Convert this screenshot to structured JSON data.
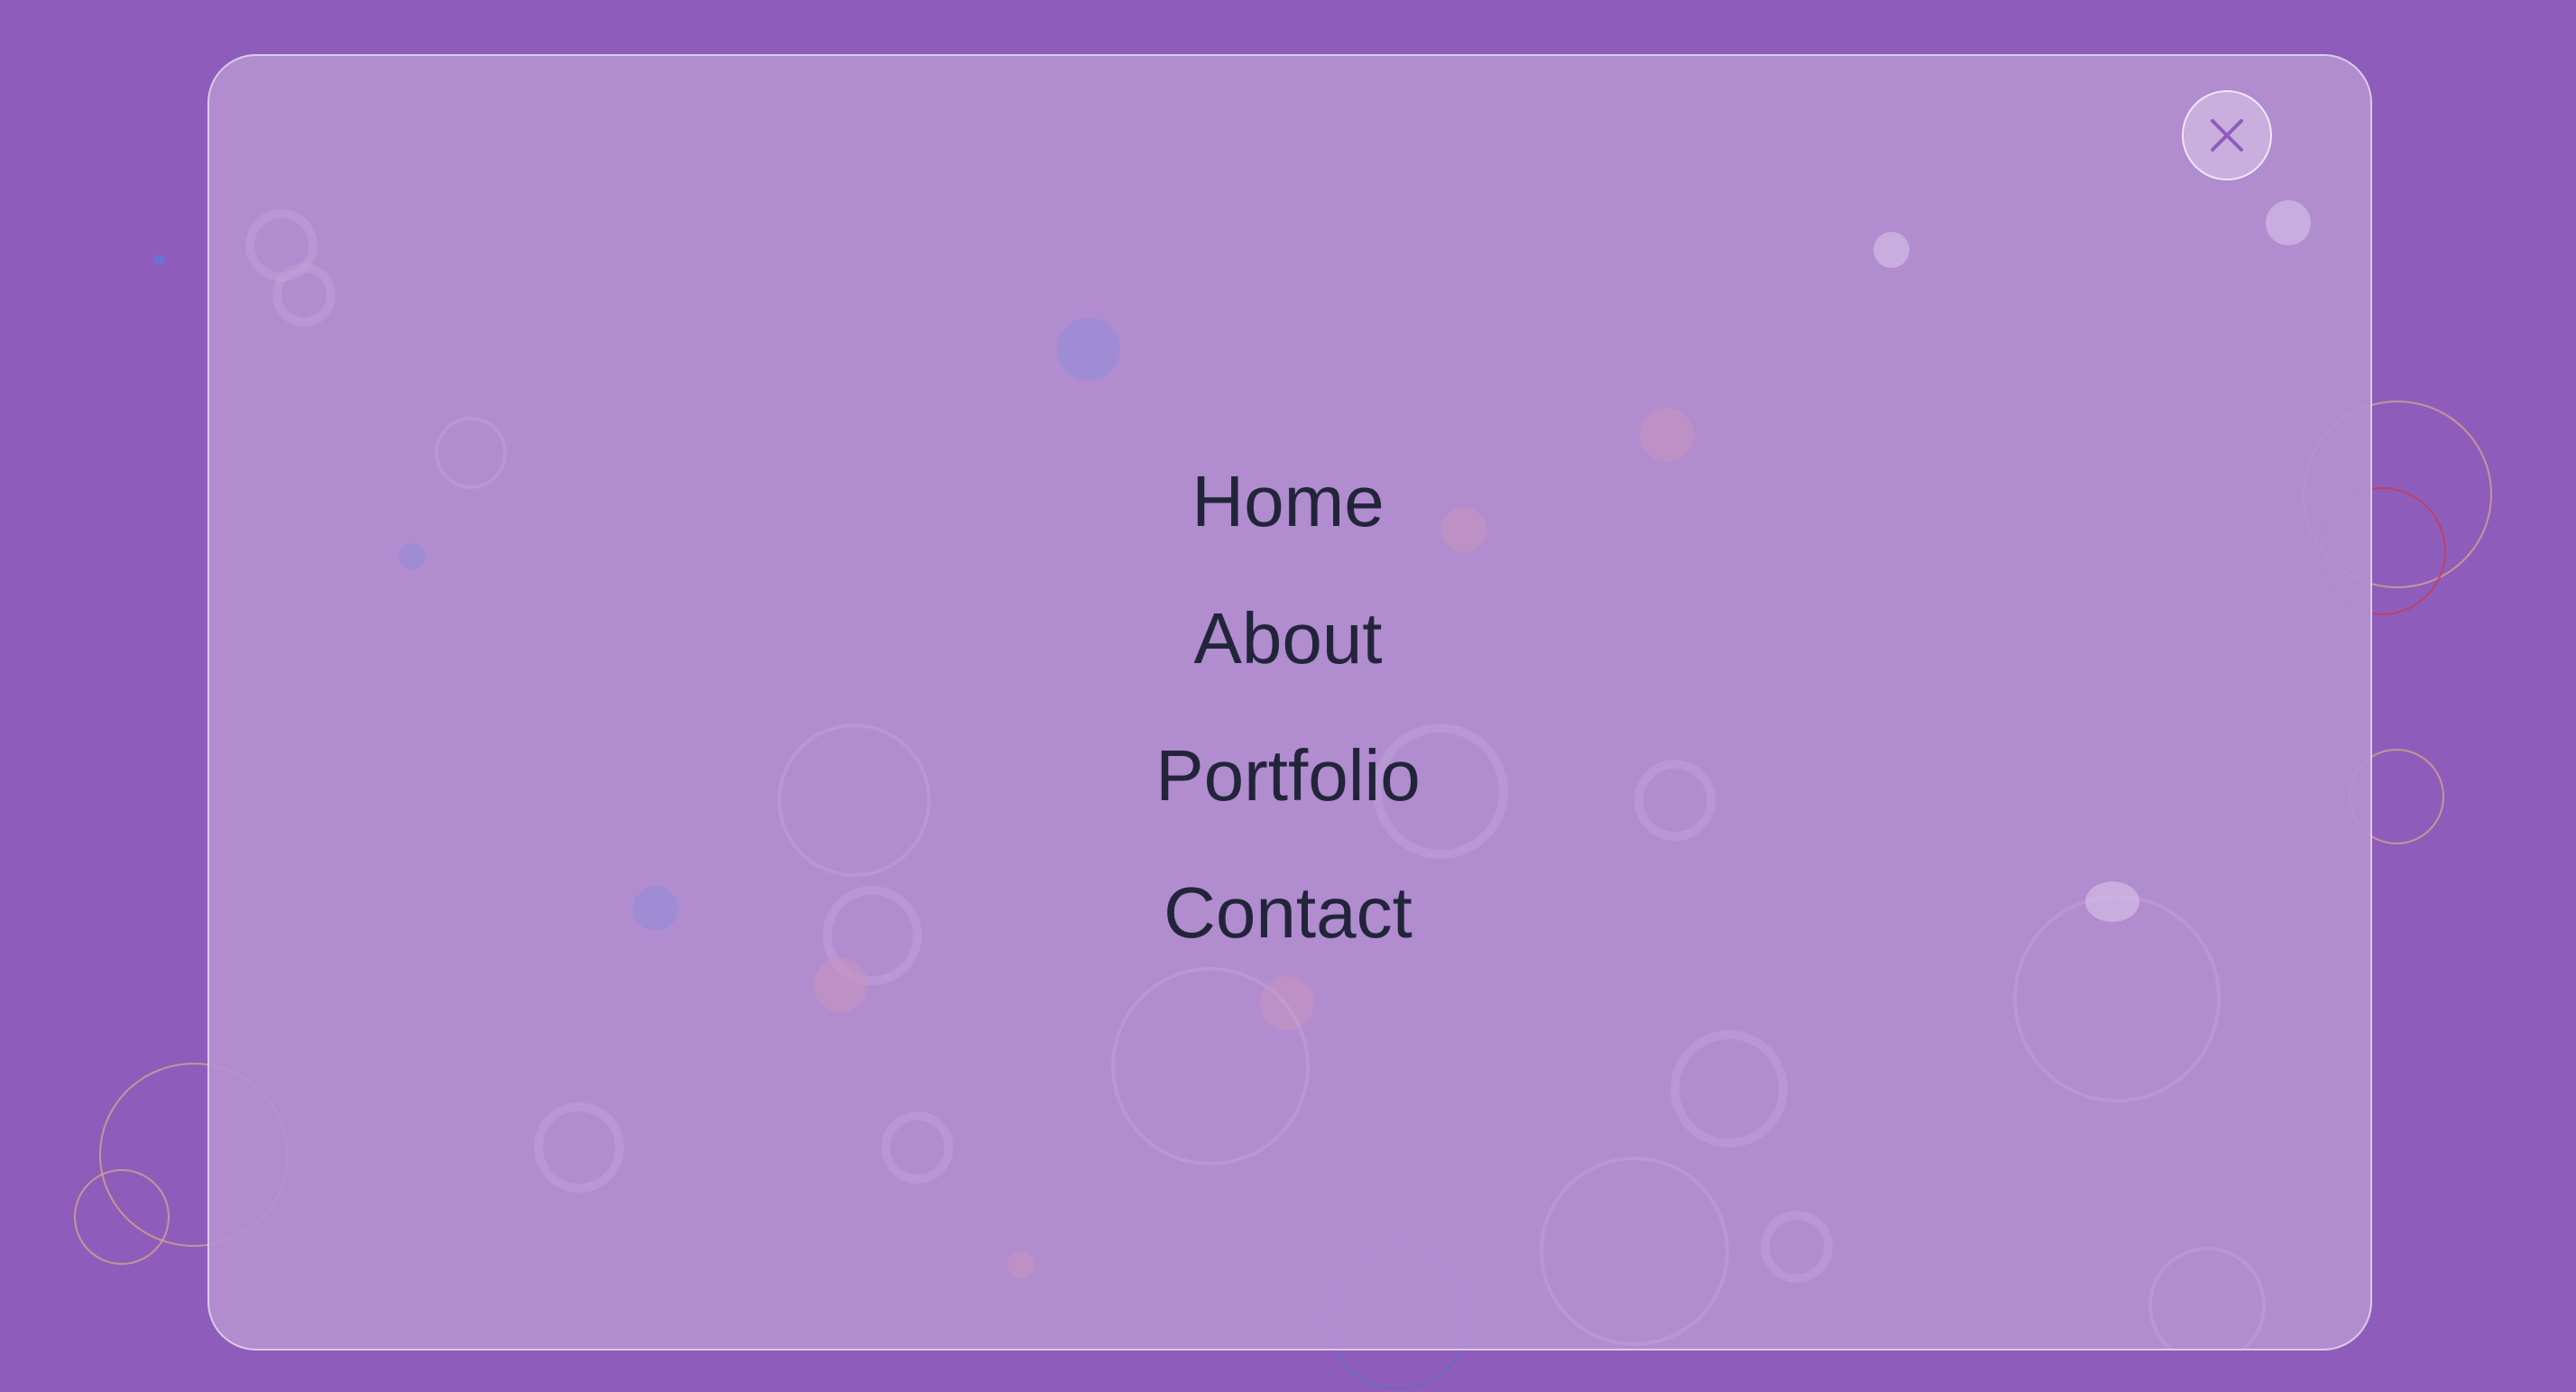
{
  "nav": {
    "items": [
      {
        "label": "Home"
      },
      {
        "label": "About"
      },
      {
        "label": "Portfolio"
      },
      {
        "label": "Contact"
      }
    ]
  },
  "close_button": {
    "icon": "close-icon"
  },
  "colors": {
    "background": "#8e5dbb",
    "panel": "#b591d1",
    "text": "#22253a",
    "close_icon": "#8e5dbb"
  }
}
